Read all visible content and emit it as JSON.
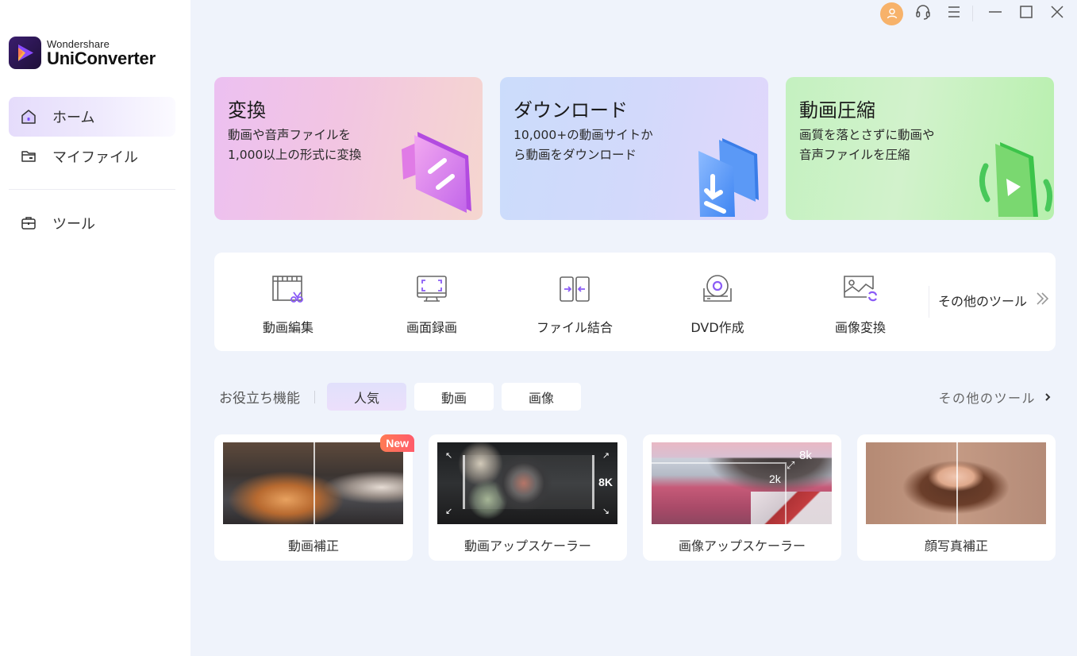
{
  "app": {
    "brand": "Wondershare",
    "product": "UniConverter"
  },
  "sidebar": {
    "items": [
      {
        "label": "ホーム",
        "icon": "home-icon",
        "active": true
      },
      {
        "label": "マイファイル",
        "icon": "folder-icon",
        "active": false
      },
      {
        "label": "ツール",
        "icon": "toolbox-icon",
        "active": false
      }
    ]
  },
  "titlebar": {
    "icons": [
      "user-avatar-icon",
      "headset-support-icon",
      "menu-icon",
      "minimize-icon",
      "maximize-icon",
      "close-icon"
    ],
    "avatar_color": "#f7b26a"
  },
  "features": [
    {
      "title": "変換",
      "desc": "動画や音声ファイルを1,000以上の形式に変換",
      "icon": "video-convert-icon"
    },
    {
      "title": "ダウンロード",
      "desc": "10,000+の動画サイトから動画をダウンロード",
      "icon": "download-icon"
    },
    {
      "title": "動画圧縮",
      "desc": "画質を落とさずに動画や音声ファイルを圧縮",
      "icon": "compress-icon"
    }
  ],
  "tools": {
    "items": [
      {
        "label": "動画編集",
        "icon": "video-edit-scissors-icon"
      },
      {
        "label": "画面録画",
        "icon": "screen-record-icon"
      },
      {
        "label": "ファイル結合",
        "icon": "file-merge-icon"
      },
      {
        "label": "DVD作成",
        "icon": "dvd-burn-icon"
      },
      {
        "label": "画像変換",
        "icon": "image-convert-icon"
      }
    ],
    "more_label": "その他のツール"
  },
  "helpful": {
    "title": "お役立ち機能",
    "tabs": [
      {
        "label": "人気",
        "active": true
      },
      {
        "label": "動画",
        "active": false
      },
      {
        "label": "画像",
        "active": false
      }
    ],
    "more_label": "その他のツール",
    "cards": [
      {
        "label": "動画補正",
        "badge": "New"
      },
      {
        "label": "動画アップスケーラー",
        "overlay": "8K"
      },
      {
        "label": "画像アップスケーラー",
        "overlay_from": "2k",
        "overlay_to": "8k"
      },
      {
        "label": "顔写真補正"
      }
    ]
  },
  "colors": {
    "accent": "#8b5cf6",
    "background": "#eff3fb",
    "badge": "#ff6a5c"
  }
}
